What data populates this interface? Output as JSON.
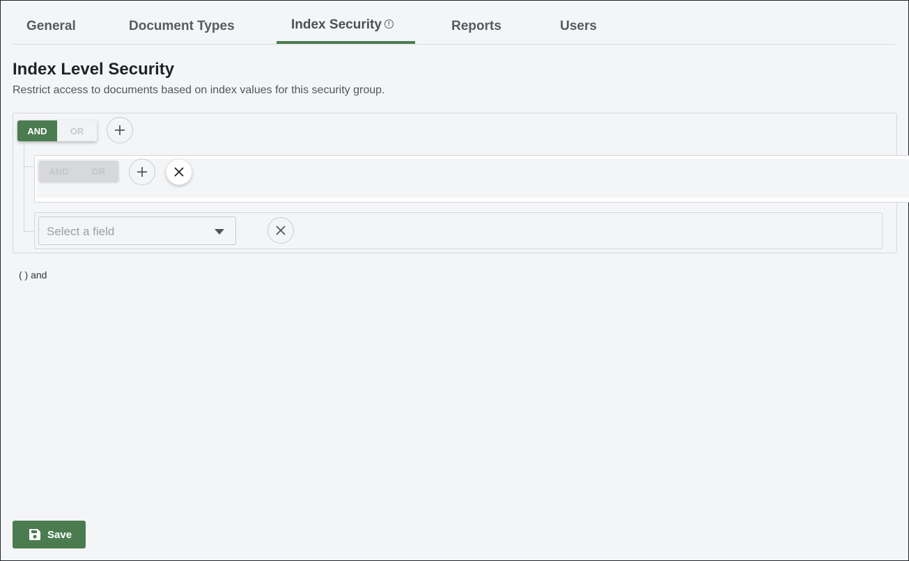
{
  "tabs": [
    {
      "label": "General"
    },
    {
      "label": "Document Types"
    },
    {
      "label": "Index Security",
      "active": true
    },
    {
      "label": "Reports"
    },
    {
      "label": "Users"
    }
  ],
  "page": {
    "title": "Index Level Security",
    "subtitle": "Restrict access to documents based on index values for this security group."
  },
  "root_group": {
    "and_label": "AND",
    "or_label": "OR",
    "selected": "AND"
  },
  "nested_group": {
    "and_label": "AND",
    "or_label": "OR",
    "disabled": true
  },
  "rule": {
    "field_placeholder": "Select a field"
  },
  "expression_preview": "( ) and",
  "actions": {
    "save_label": "Save"
  },
  "icons": {
    "tab_info": "info-icon",
    "add": "plus-icon",
    "remove": "close-icon",
    "dropdown": "chevron-down-icon",
    "save": "floppy-disk-icon"
  },
  "colors": {
    "accent": "#4a7c50",
    "background": "#f4f5f7",
    "border": "#d4d6d9"
  }
}
